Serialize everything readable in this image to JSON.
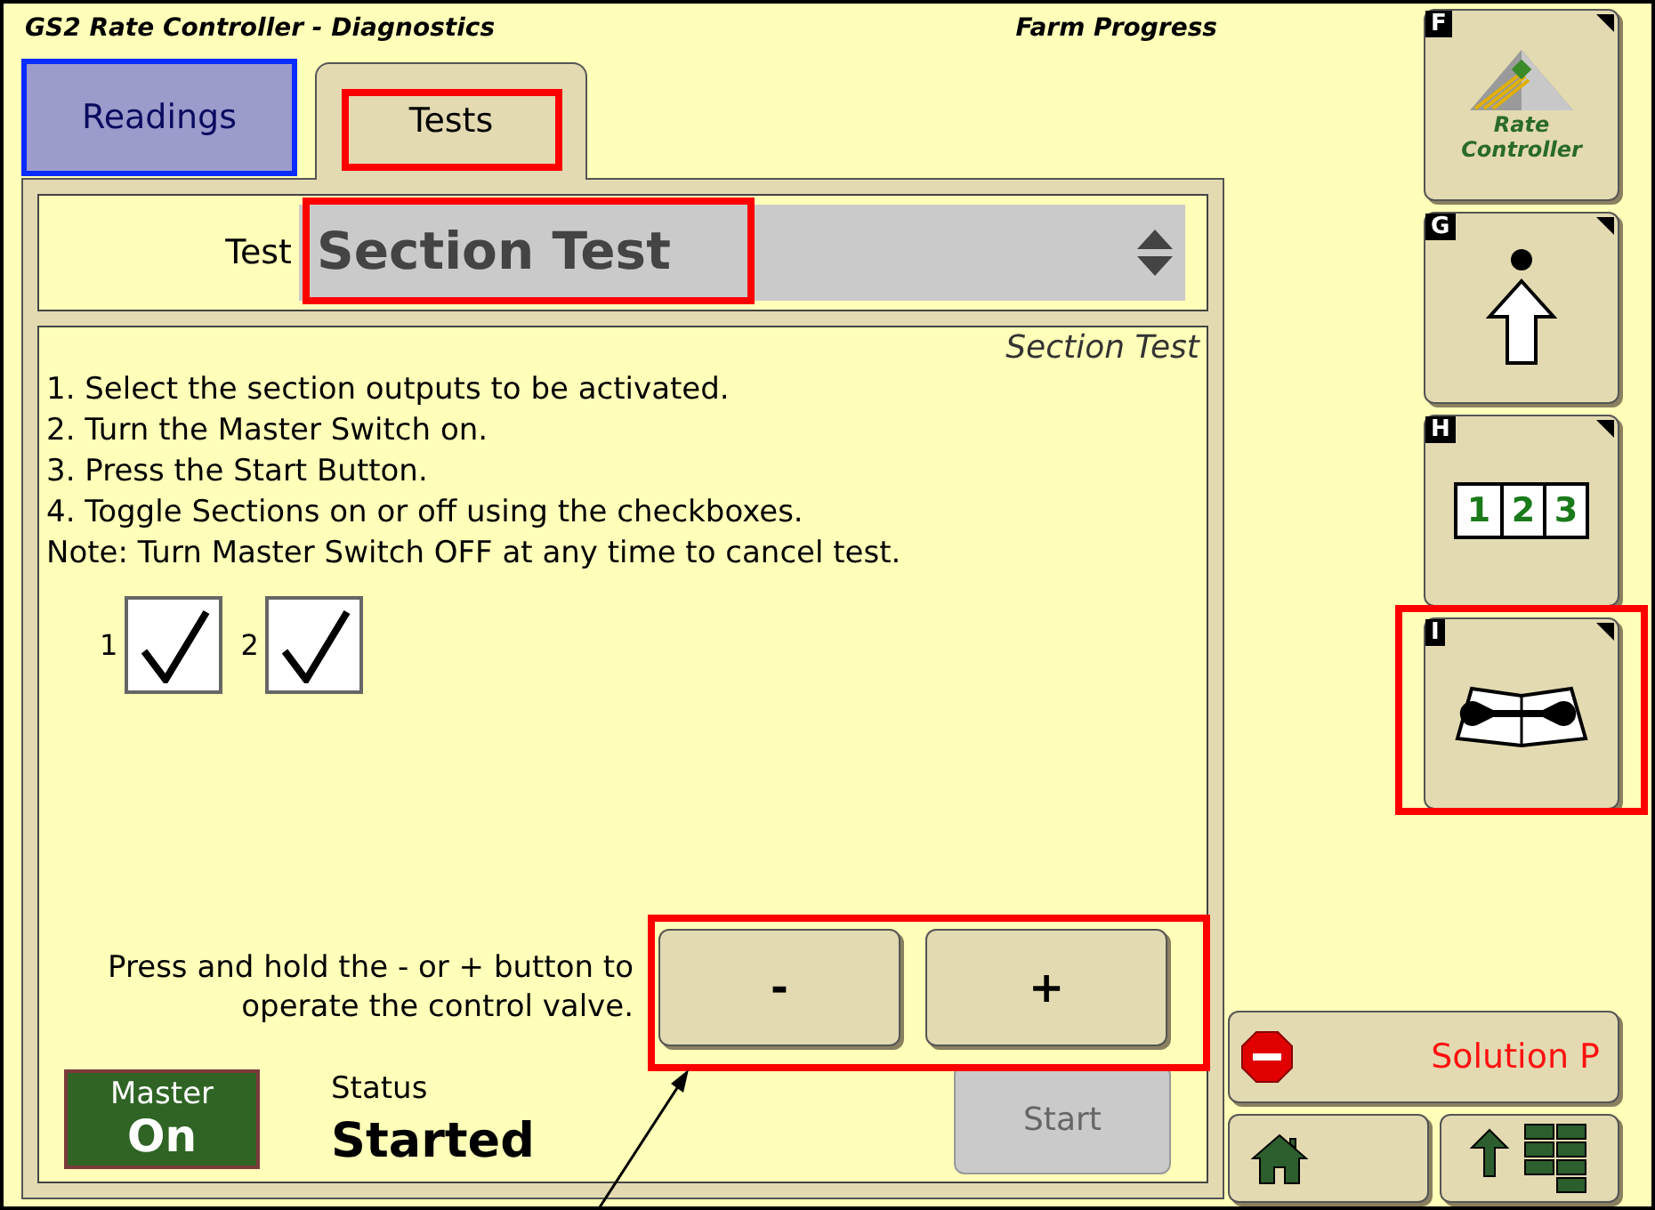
{
  "header": {
    "title": "GS2 Rate Controller - Diagnostics",
    "brand": "Farm Progress"
  },
  "tabs": [
    {
      "label": "Readings",
      "selected": false
    },
    {
      "label": "Tests",
      "selected": true
    }
  ],
  "test_selector": {
    "label": "Test",
    "value": "Section Test"
  },
  "section": {
    "title": "Section Test",
    "instructions": [
      "1. Select the section outputs to be activated.",
      "2. Turn the Master Switch on.",
      "3. Press the Start Button.",
      "4. Toggle Sections on or off using the checkboxes.",
      "Note: Turn Master Switch OFF at any time to cancel test."
    ],
    "checkboxes": [
      {
        "label": "1",
        "checked": true
      },
      {
        "label": "2",
        "checked": true
      }
    ],
    "hold_text": "Press and hold the - or + button to operate the control valve.",
    "valve_buttons": [
      "-",
      "+"
    ],
    "master": {
      "label": "Master",
      "value": "On",
      "on": true
    },
    "status": {
      "label": "Status",
      "value": "Started"
    },
    "start_button": {
      "label": "Start",
      "disabled": true
    }
  },
  "softkeys": [
    {
      "letter": "F",
      "kind": "logo",
      "logo_text": "Rate Controller"
    },
    {
      "letter": "G",
      "kind": "arrow"
    },
    {
      "letter": "H",
      "kind": "counter",
      "digits": [
        "1",
        "2",
        "3"
      ]
    },
    {
      "letter": "I",
      "kind": "manual"
    }
  ],
  "alarm_button": {
    "label": "Solution P"
  },
  "nav_buttons": [
    {
      "kind": "home"
    },
    {
      "kind": "layout"
    }
  ]
}
